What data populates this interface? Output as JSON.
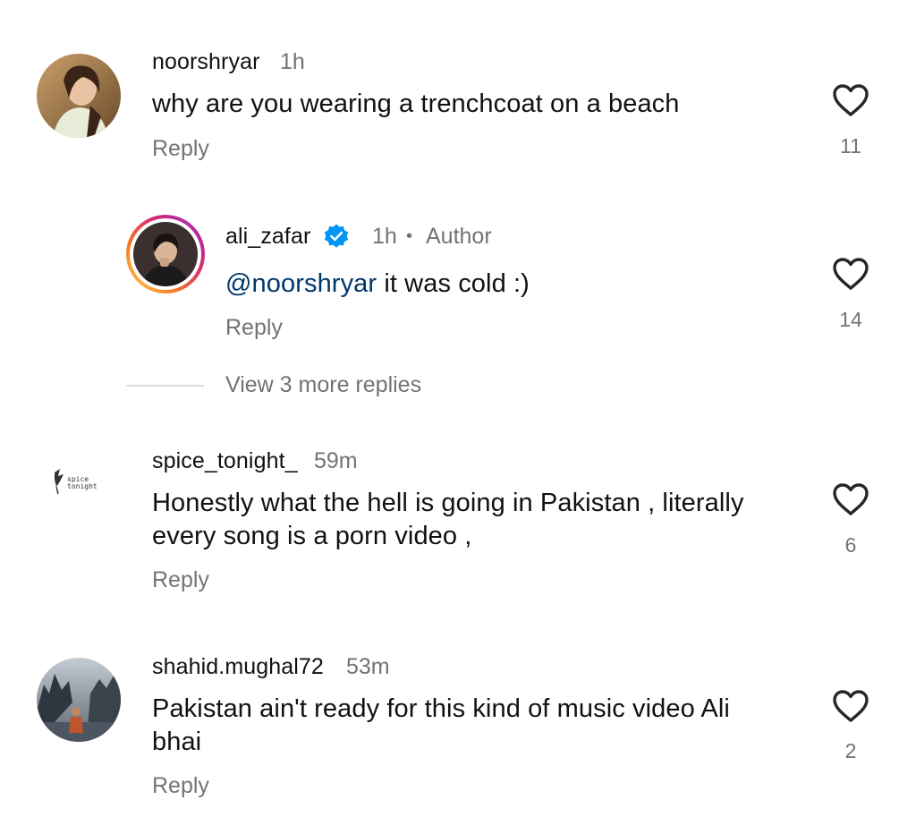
{
  "comments": [
    {
      "username": "noorshryar",
      "time": "1h",
      "text": "why are you wearing a trenchcoat on a beach",
      "reply_label": "Reply",
      "likes": "11"
    },
    {
      "username": "ali_zafar",
      "time": "1h",
      "separator": "•",
      "role": "Author",
      "mention": "@noorshryar",
      "text": " it was cold :)",
      "reply_label": "Reply",
      "likes": "14",
      "verified": true
    },
    {
      "username": "spice_tonight_",
      "time": "59m",
      "text_line1": "Honestly what the hell is going in Pakistan , literally",
      "text_line2": "every song is a porn video ,",
      "reply_label": "Reply",
      "likes": "6",
      "avatar_text_line1": "spice",
      "avatar_text_line2": "tonight"
    },
    {
      "username": "shahid.mughal72",
      "time": "53m",
      "text_line1": "Pakistan ain't ready for this kind of music video Ali",
      "text_line2": "bhai",
      "reply_label": "Reply",
      "likes": "2"
    }
  ],
  "view_more_replies": "View 3 more replies",
  "colors": {
    "secondary_text": "#737373",
    "mention": "#00376b",
    "verified_badge": "#0095f6",
    "story_ring_start": "#feda75",
    "story_ring_end": "#d62976"
  },
  "icons": {
    "like": "heart-outline-icon",
    "verified": "verified-badge-icon"
  }
}
